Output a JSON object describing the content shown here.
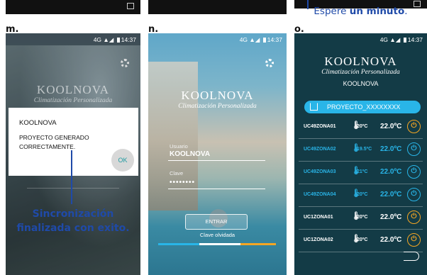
{
  "top_caption": {
    "prefix": "Espere ",
    "bold": "un minuto",
    "suffix": "."
  },
  "labels": {
    "m": "m.",
    "n": "n.",
    "o": "o."
  },
  "status": {
    "network": "4G",
    "time": "14:37"
  },
  "brand": {
    "name": "KOOLNOVA",
    "tagline": "Climatización Personalizada"
  },
  "phone_m": {
    "dialog_title": "KOOLNOVA",
    "dialog_message": "PROYECTO GENERADO CORRECTAMENTE.",
    "ok_label": "OK",
    "caption_line1": "Sincronización",
    "caption_line2": "finalizada con exito."
  },
  "phone_n": {
    "user_label": "Usuario",
    "user_value": "KOOLNOVA",
    "password_label": "Clave",
    "password_value": "••••••••",
    "enter_label": "ENTRAR",
    "forgot_label": "Clave olvidada"
  },
  "phone_o": {
    "user": "KOOLNOVA",
    "project": "PROYECTO_XXXXXXXX",
    "zones": [
      {
        "name": "UC49ZONA01",
        "current": "20ºC",
        "setpoint": "22.0ºC",
        "state": "off",
        "color": "#ffffff",
        "power_color": "#f5a623"
      },
      {
        "name": "UC49ZONA02",
        "current": "19.5ºC",
        "setpoint": "22.0ºC",
        "state": "on",
        "color": "#29b5e8",
        "power_color": "#29b5e8"
      },
      {
        "name": "UC49ZONA03",
        "current": "21ºC",
        "setpoint": "22.0ºC",
        "state": "on",
        "color": "#29b5e8",
        "power_color": "#29b5e8"
      },
      {
        "name": "UC49ZONA04",
        "current": "20ºC",
        "setpoint": "22.0ºC",
        "state": "on",
        "color": "#29b5e8",
        "power_color": "#29b5e8"
      },
      {
        "name": "UC1ZONA01",
        "current": "20ºC",
        "setpoint": "22.0ºC",
        "state": "off",
        "color": "#ffffff",
        "power_color": "#f5a623"
      },
      {
        "name": "UC1ZONA02",
        "current": "20ºC",
        "setpoint": "22.0ºC",
        "state": "off",
        "color": "#ffffff",
        "power_color": "#f5a623"
      }
    ]
  },
  "colors": {
    "caption_blue": "#1f4aa8",
    "accent_blue": "#29b5e8",
    "accent_orange": "#f5a623",
    "panel_teal": "#133b46"
  }
}
